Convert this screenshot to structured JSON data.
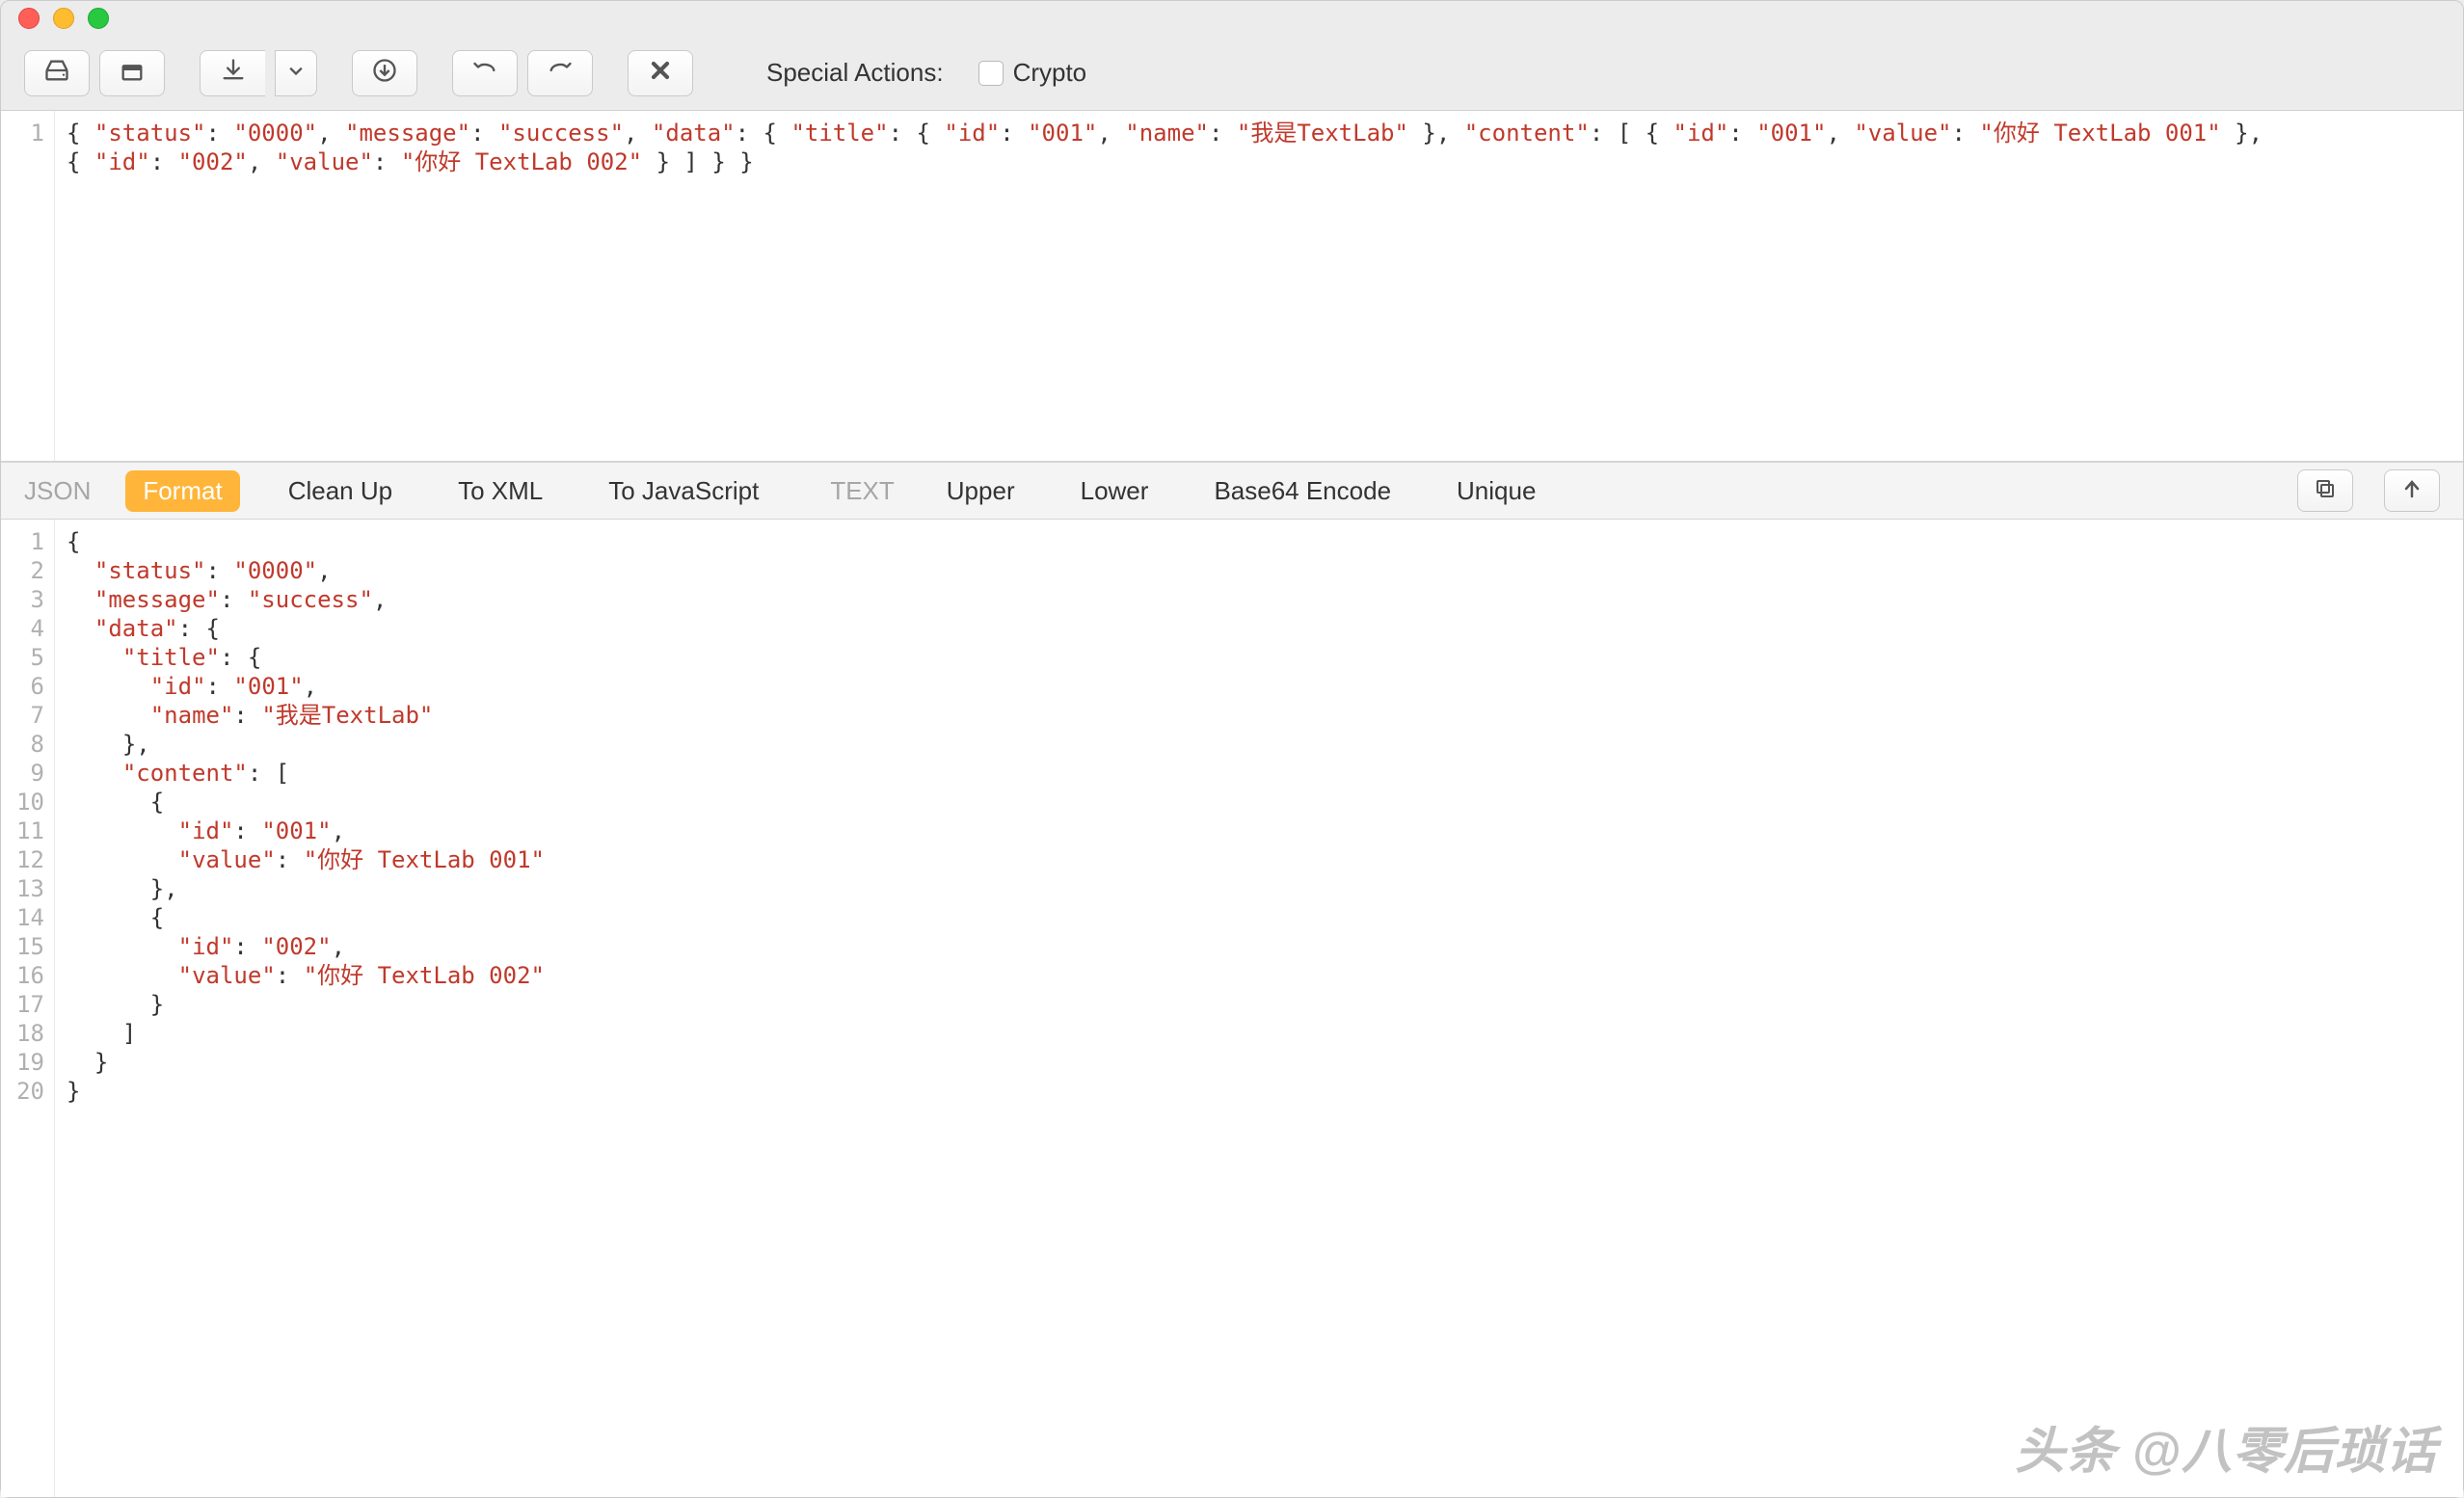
{
  "titlebar": {
    "close": "close",
    "min": "minimize",
    "max": "maximize"
  },
  "toolbar": {
    "btn_disk": "disk",
    "btn_eject": "eject",
    "btn_download": "download",
    "btn_down_menu": "dropdown",
    "btn_circle_down": "circle-down",
    "btn_undo": "undo",
    "btn_redo": "redo",
    "btn_clear": "clear",
    "special_actions_label": "Special Actions:",
    "crypto_label": "Crypto"
  },
  "input_editor": {
    "line_start": 1,
    "line1": "{ \"status\": \"0000\", \"message\": \"success\", \"data\": { \"title\": { \"id\": \"001\", \"name\": \"我是TextLab\" }, \"content\": [ { \"id\": \"001\", \"value\": \"你好 TextLab 001\" },",
    "line2": "{ \"id\": \"002\", \"value\": \"你好 TextLab 002\" } ] } }"
  },
  "midbar": {
    "json_label": "JSON",
    "tabs_json": [
      "Format",
      "Clean Up",
      "To XML",
      "To JavaScript"
    ],
    "active_json_tab": "Format",
    "text_label": "TEXT",
    "tabs_text": [
      "Upper",
      "Lower",
      "Base64 Encode",
      "Unique"
    ],
    "btn_copy": "copy",
    "btn_up": "send-up"
  },
  "output_editor": {
    "lines": [
      "{",
      "  \"status\": \"0000\",",
      "  \"message\": \"success\",",
      "  \"data\": {",
      "    \"title\": {",
      "      \"id\": \"001\",",
      "      \"name\": \"我是TextLab\"",
      "    },",
      "    \"content\": [",
      "      {",
      "        \"id\": \"001\",",
      "        \"value\": \"你好 TextLab 001\"",
      "      },",
      "      {",
      "        \"id\": \"002\",",
      "        \"value\": \"你好 TextLab 002\"",
      "      }",
      "    ]",
      "  }",
      "}"
    ]
  },
  "watermark": "头条 @八零后琐话"
}
